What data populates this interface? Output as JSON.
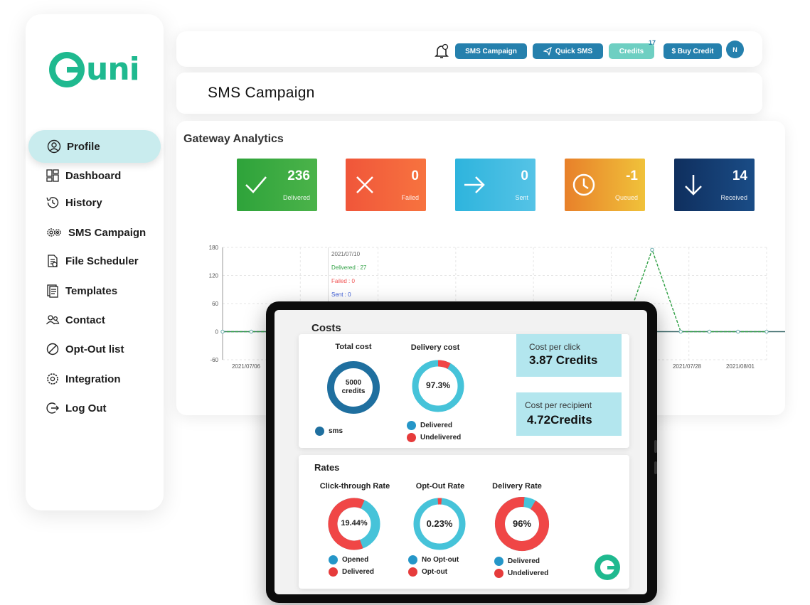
{
  "brand": {
    "logo_text": "uni",
    "logo_letter": "G",
    "accent": "#1fb98f"
  },
  "sidebar": {
    "items": [
      {
        "label": "Profile",
        "icon": "user-circle-icon",
        "active": true
      },
      {
        "label": "Dashboard",
        "icon": "dashboard-grid-icon"
      },
      {
        "label": "History",
        "icon": "history-icon"
      },
      {
        "label": "SMS Campaign",
        "icon": "gears-icon"
      },
      {
        "label": "File Scheduler",
        "icon": "file-scheduler-icon"
      },
      {
        "label": "Templates",
        "icon": "templates-icon"
      },
      {
        "label": "Contact",
        "icon": "contact-icon"
      },
      {
        "label": "Opt-Out list",
        "icon": "opt-out-icon"
      },
      {
        "label": "Integration",
        "icon": "gear-icon"
      },
      {
        "label": "Log Out",
        "icon": "logout-icon"
      }
    ]
  },
  "topbar": {
    "sms_campaign": "SMS Campaign",
    "quick_sms": "Quick SMS",
    "credits": "Credits",
    "credits_badge": "17",
    "buy_credit": "$ Buy Credit",
    "avatar": "N"
  },
  "page": {
    "title": "SMS Campaign"
  },
  "analytics": {
    "title": "Gateway Analytics",
    "stats": [
      {
        "value": "236",
        "label": "Delivered",
        "icon": "check-icon",
        "color": "#3aa53c"
      },
      {
        "value": "0",
        "label": "Failed",
        "icon": "x-icon",
        "color": "#f25c3a"
      },
      {
        "value": "0",
        "label": "Sent",
        "icon": "arrow-right-icon",
        "color": "#35b3dd"
      },
      {
        "value": "-1",
        "label": "Queued",
        "icon": "clock-icon",
        "color": "#e9a42a"
      },
      {
        "value": "14",
        "label": "Received",
        "icon": "arrow-down-icon",
        "color": "#163a6e"
      }
    ],
    "tooltip": {
      "date": "2021/07/10",
      "delivered": "Delivered : 27",
      "failed": "Failed : 0",
      "sent": "Sent : 0"
    }
  },
  "chart_data": {
    "type": "line",
    "yticks": [
      "180",
      "120",
      "60",
      "0",
      "-60"
    ],
    "ylim": [
      -60,
      180
    ],
    "xticks": [
      "2021/07/06",
      "2021/07/28",
      "2021/08/01"
    ],
    "grid": true,
    "series": [
      {
        "name": "Delivered",
        "color": "#2ea043",
        "x": [
          0,
          1,
          2,
          3,
          4,
          5,
          6,
          7,
          8,
          9,
          10,
          11,
          12,
          13,
          14,
          15,
          16,
          17,
          18,
          19
        ],
        "values": [
          0,
          0,
          0,
          0,
          27,
          0,
          0,
          0,
          0,
          0,
          0,
          0,
          0,
          0,
          0,
          175,
          0,
          0,
          0,
          0
        ]
      }
    ]
  },
  "tablet": {
    "costs": {
      "title": "Costs",
      "total_cost": {
        "title": "Total cost",
        "value": "5000",
        "value_sub": "credits",
        "legend": [
          "sms"
        ]
      },
      "delivery_cost": {
        "title": "Delivery cost",
        "value": "97.3%",
        "legend": [
          "Delivered",
          "Undelivered"
        ]
      },
      "cost_per_click": {
        "label": "Cost  per click",
        "value": "3.87 Credits"
      },
      "cost_per_recipient": {
        "label": "Cost  per recipient",
        "value": "4.72Credits"
      }
    },
    "rates": {
      "title": "Rates",
      "ctr": {
        "title": "Click-through Rate",
        "value": "19.44%",
        "legend": [
          "Opened",
          "Delivered"
        ]
      },
      "optout": {
        "title": "Opt-Out Rate",
        "value": "0.23%",
        "legend": [
          "No Opt-out",
          "Opt-out"
        ]
      },
      "delivery": {
        "title": "Delivery Rate",
        "value": "96%",
        "legend": [
          "Delivered",
          "Undelivered"
        ]
      }
    },
    "colors": {
      "primary": "#1f6f9f",
      "cyan": "#46c3d9",
      "red": "#f04646",
      "dot_blue": "#2596c8",
      "dot_red": "#e63b3b"
    }
  }
}
